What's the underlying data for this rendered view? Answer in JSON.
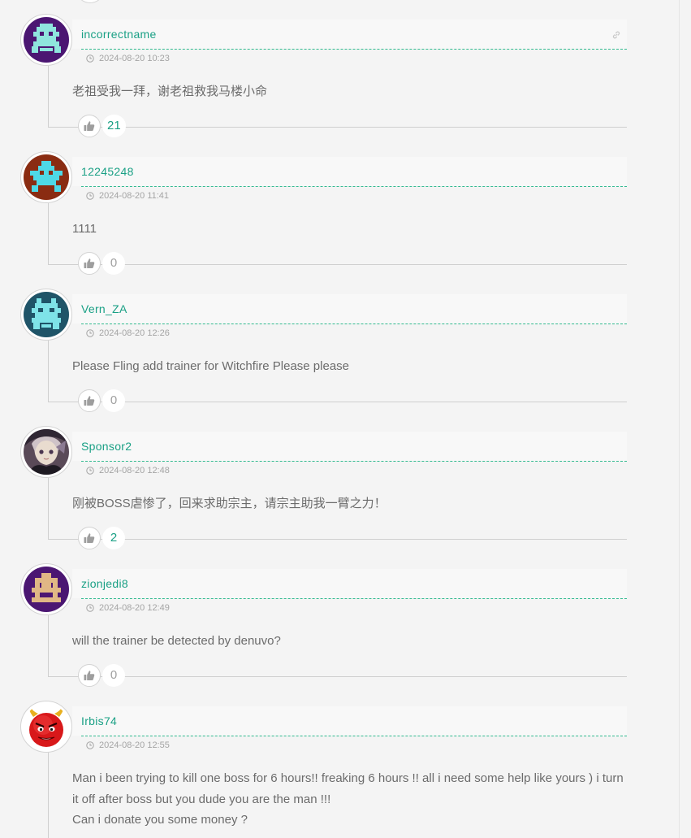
{
  "comments": [
    {
      "username": "incorrectname",
      "time": "2024-08-20 10:23",
      "text": "老祖受我一拜，谢老祖救我马楼小命",
      "likes": "21",
      "avatar": {
        "type": "pixel",
        "bg": "#4b1672",
        "fg": "#8fe5dd",
        "pattern": "alien-a"
      }
    },
    {
      "username": "12245248",
      "time": "2024-08-20 11:41",
      "text": "1111",
      "likes": "0",
      "avatar": {
        "type": "pixel",
        "bg": "#8a2c12",
        "fg": "#4ed9e6",
        "pattern": "alien-b"
      }
    },
    {
      "username": "Vern_ZA",
      "time": "2024-08-20 12:26",
      "text": "Please Fling add trainer for Witchfire Please please",
      "likes": "0",
      "avatar": {
        "type": "pixel",
        "bg": "#1f5468",
        "fg": "#7ee3e8",
        "pattern": "alien-c"
      }
    },
    {
      "username": "Sponsor2",
      "time": "2024-08-20 12:48",
      "text": "刚被BOSS虐惨了，回来求助宗主，请宗主助我一臂之力！",
      "likes": "2",
      "avatar": {
        "type": "anime",
        "bg": "#5a4a58"
      }
    },
    {
      "username": "zionjedi8",
      "time": "2024-08-20 12:49",
      "text": "will the trainer be detected by denuvo?",
      "likes": "0",
      "avatar": {
        "type": "pixel",
        "bg": "#4b1672",
        "fg": "#e0b785",
        "pattern": "alien-d"
      }
    },
    {
      "username": "Irbis74",
      "time": "2024-08-20 12:55",
      "text": "Man i been trying to kill one boss for 6 hours!! freaking 6 hours !! all i need some help like yours ) i turn it off after boss but you dude you are the man !!!\nCan i donate you some money ?",
      "likes": "",
      "avatar": {
        "type": "devil",
        "bg": "#ffffff"
      }
    }
  ],
  "colors": {
    "accent": "#1aa085",
    "dash": "#33bb90",
    "text": "#6b6b6b",
    "meta": "#a4a4a4"
  },
  "icons": {
    "like": "thumbs-up-icon",
    "clock": "clock-icon",
    "link": "link-icon"
  }
}
